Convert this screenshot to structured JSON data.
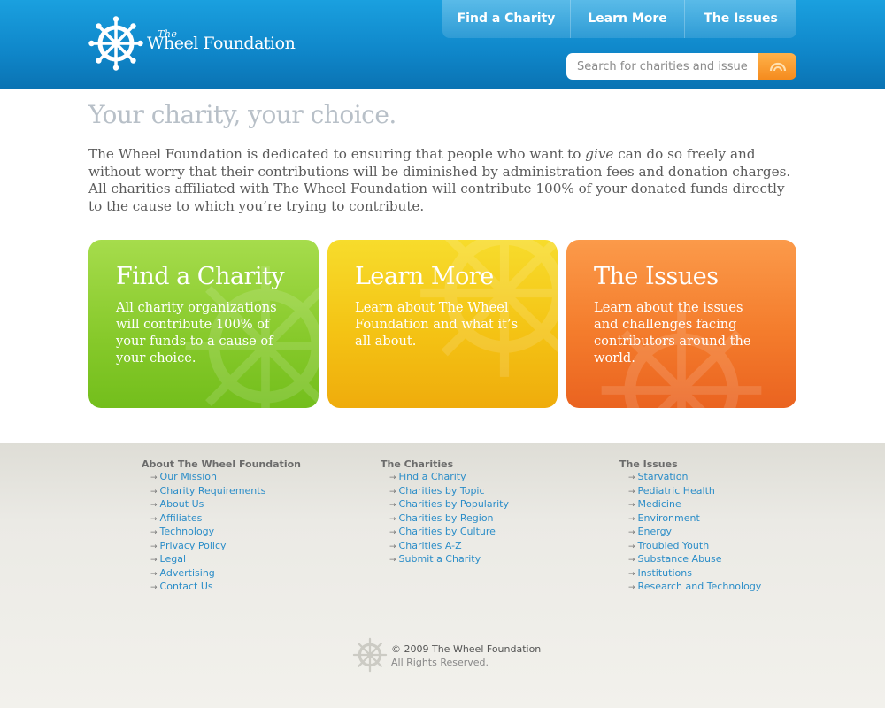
{
  "brand": {
    "the": "The",
    "name": "Wheel Foundation",
    "logo_icon": "ship-wheel-icon"
  },
  "nav": {
    "items": [
      {
        "label": "Find a Charity"
      },
      {
        "label": "Learn More"
      },
      {
        "label": "The Issues"
      }
    ]
  },
  "search": {
    "placeholder": "Search for charities and issues",
    "button_icon": "search-icon"
  },
  "main": {
    "headline": "Your charity, your choice.",
    "intro_part1": "The Wheel Foundation is dedicated to ensuring that people who want to ",
    "intro_emphasis": "give",
    "intro_part2": " can do so freely and without worry that their contributions will be diminished by administration fees and donation charges.  All charities affiliated with The Wheel Foundation will contribute 100% of your donated funds directly to the cause to which you’re trying to contribute."
  },
  "cards": [
    {
      "title": "Find a Charity",
      "text": "All charity organizations will contribute 100% of your funds to a cause of your choice.",
      "color": "#86c92a"
    },
    {
      "title": "Learn More",
      "text": "Learn about The Wheel Foundation and what it’s all about.",
      "color": "#f4c314"
    },
    {
      "title": "The Issues",
      "text": "Learn about the issues and challenges facing contributors around the world.",
      "color": "#f47c2c"
    }
  ],
  "footer": {
    "columns": [
      {
        "heading": "About The Wheel Foundation",
        "links": [
          "Our Mission",
          "Charity Requirements",
          "About Us",
          "Affiliates",
          "Technology",
          "Privacy Policy",
          "Legal",
          "Advertising",
          "Contact Us"
        ]
      },
      {
        "heading": "The Charities",
        "links": [
          "Find a Charity",
          "Charities by Topic",
          "Charities by Popularity",
          "Charities by Region",
          "Charities by Culture",
          "Charities A-Z",
          "Submit a Charity"
        ]
      },
      {
        "heading": "The Issues",
        "links": [
          "Starvation",
          "Pediatric Health",
          "Medicine",
          "Environment",
          "Energy",
          "Troubled Youth",
          "Substance Abuse",
          "Institutions",
          "Research and Technology"
        ]
      }
    ],
    "copyright": "© 2009 The Wheel Foundation",
    "rights": "All Rights Reserved."
  },
  "colors": {
    "header_blue": "#1aa0df",
    "link_blue": "#2b8dc8",
    "search_orange": "#f58b1e"
  }
}
